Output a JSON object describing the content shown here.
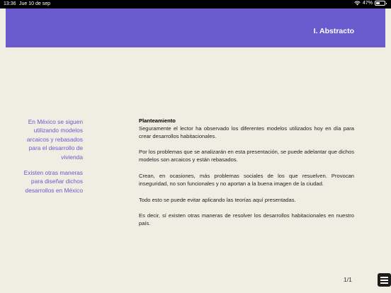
{
  "status": {
    "time": "13:36",
    "date": "Jue 10 de sep",
    "battery": "47%",
    "battery_level": 0.47
  },
  "header": {
    "title": "I. Abstracto"
  },
  "sidebar": {
    "note1": "En México se siguen utilizando modelos arcaicos y rebasados para el desarrollo de vivienda",
    "note2": "Existen otras maneras para diseñar dichos desarrollos en México"
  },
  "content": {
    "heading": "Planteamiento",
    "paragraphs": [
      "Seguramente el lector ha observado los diferentes modelos utilizados hoy en día para crear desarrollos habitacionales.",
      "Por los problemas que se analizarán en esta presentación, se puede adelantar que dichos modelos son arcaicos y están rebasados.",
      "Crean, en ocasiones, más problemas sociales de los que resuelven. Provocan inseguridad, no son funcionales y no aportan a la buena imagen de la ciudad.",
      "Todo esto se puede evitar aplicando las teorías aquí presentadas.",
      "Es decir, sí existen otras maneras de resolver los desarrollos habitacionales en nuestro país."
    ]
  },
  "footer": {
    "page": "1/1"
  },
  "icons": {
    "wifi": "wifi-icon",
    "battery": "battery-icon",
    "menu": "menu-icon"
  },
  "colors": {
    "accent": "#6a5acd",
    "background": "#f0ede3"
  }
}
